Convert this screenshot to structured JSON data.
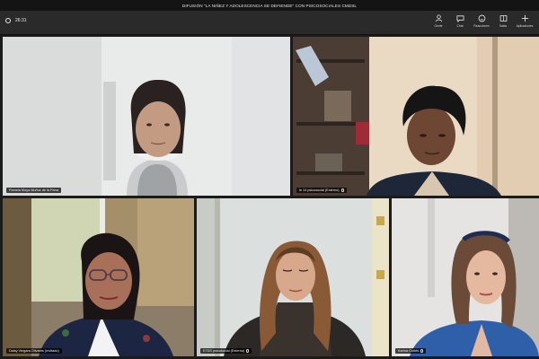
{
  "meeting": {
    "title": "DIFUSIÓN \"LA NIÑEZ Y ADOLESCENCIA SE DEFIENDE\" CON PSICOSOCIALES CMDSL"
  },
  "toolbar": {
    "elapsed": "26:31",
    "buttons": [
      {
        "label": "Gente",
        "icon": "people-icon"
      },
      {
        "label": "Chat",
        "icon": "chat-icon"
      },
      {
        "label": "Reacciones",
        "icon": "reactions-icon"
      },
      {
        "label": "Salas",
        "icon": "rooms-icon"
      },
      {
        "label": "Aplicaciones",
        "icon": "apps-icon"
      }
    ]
  },
  "participants": [
    {
      "name": "Pamela Moya Muñoz de la Parra"
    },
    {
      "name": "ie 14 psicosocial (Externo)"
    },
    {
      "name": "Daisy Vergara Olivares (Invitado)"
    },
    {
      "name": "E7DS psicosocial (Externo)"
    },
    {
      "name": "Karina Cortés"
    }
  ]
}
